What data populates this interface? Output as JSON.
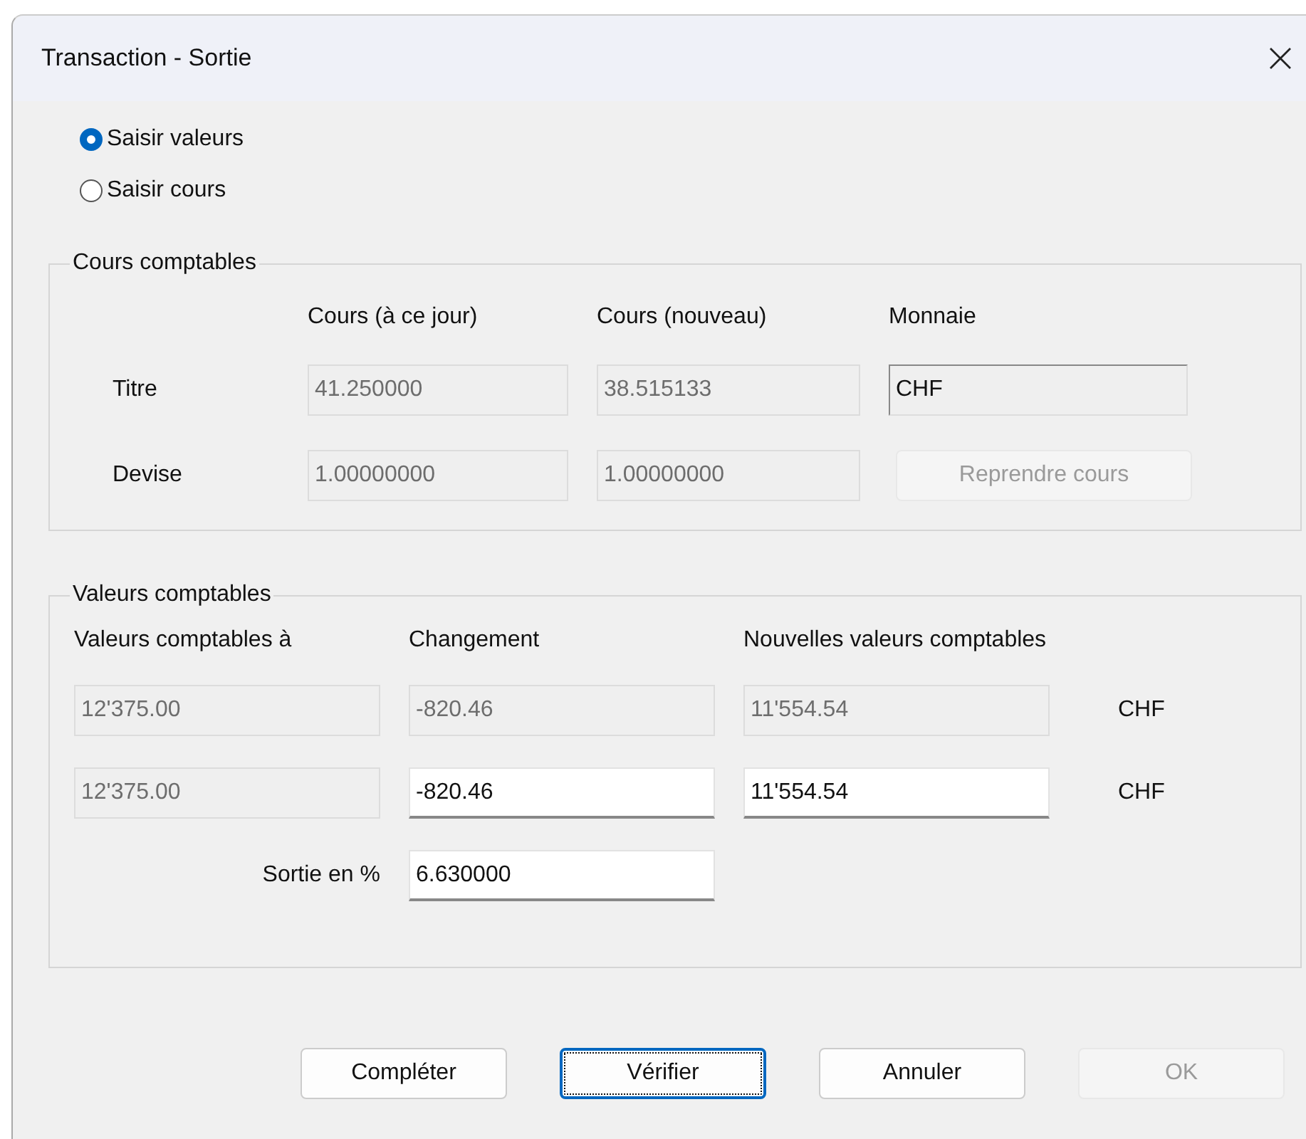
{
  "window": {
    "title": "Transaction - Sortie"
  },
  "modes": [
    {
      "label": "Saisir valeurs",
      "selected": true
    },
    {
      "label": "Saisir cours",
      "selected": false
    }
  ],
  "cours_comptables": {
    "title": "Cours comptables",
    "columns": [
      "Cours (à ce jour)",
      "Cours (nouveau)",
      "Monnaie"
    ],
    "rows": [
      {
        "label": "Titre",
        "cells": [
          {
            "kind": "field",
            "value": "41.250000",
            "disabled": true
          },
          {
            "kind": "field",
            "value": "38.515133",
            "disabled": true
          },
          {
            "kind": "readonly",
            "value": "CHF"
          }
        ]
      },
      {
        "label": "Devise",
        "cells": [
          {
            "kind": "field",
            "value": "1.00000000",
            "disabled": true
          },
          {
            "kind": "field",
            "value": "1.00000000",
            "disabled": true
          },
          {
            "kind": "button",
            "label": "Reprendre cours",
            "disabled": true
          }
        ]
      }
    ]
  },
  "valeurs_comptables": {
    "title": "Valeurs comptables",
    "columns": [
      "Valeurs comptables à",
      "Changement",
      "Nouvelles valeurs comptables"
    ],
    "rows": [
      {
        "cells": [
          {
            "kind": "field",
            "value": "12'375.00",
            "disabled": true
          },
          {
            "kind": "field",
            "value": "-820.46",
            "disabled": true
          },
          {
            "kind": "field",
            "value": "11'554.54",
            "disabled": true
          },
          {
            "kind": "unit",
            "value": "CHF"
          }
        ]
      },
      {
        "cells": [
          {
            "kind": "field",
            "value": "12'375.00",
            "disabled": true
          },
          {
            "kind": "field",
            "value": "-820.46",
            "disabled": false
          },
          {
            "kind": "field",
            "value": "11'554.54",
            "disabled": false
          },
          {
            "kind": "unit",
            "value": "CHF"
          }
        ]
      },
      {
        "cells": [
          {
            "kind": "label",
            "value": "Sortie en %"
          },
          {
            "kind": "field",
            "value": "6.630000",
            "disabled": false
          }
        ]
      }
    ]
  },
  "buttons": [
    {
      "label": "Compléter",
      "disabled": false,
      "focused": false
    },
    {
      "label": "Vérifier",
      "disabled": false,
      "focused": true
    },
    {
      "label": "Annuler",
      "disabled": false,
      "focused": false
    },
    {
      "label": "OK",
      "disabled": true,
      "focused": false
    }
  ]
}
